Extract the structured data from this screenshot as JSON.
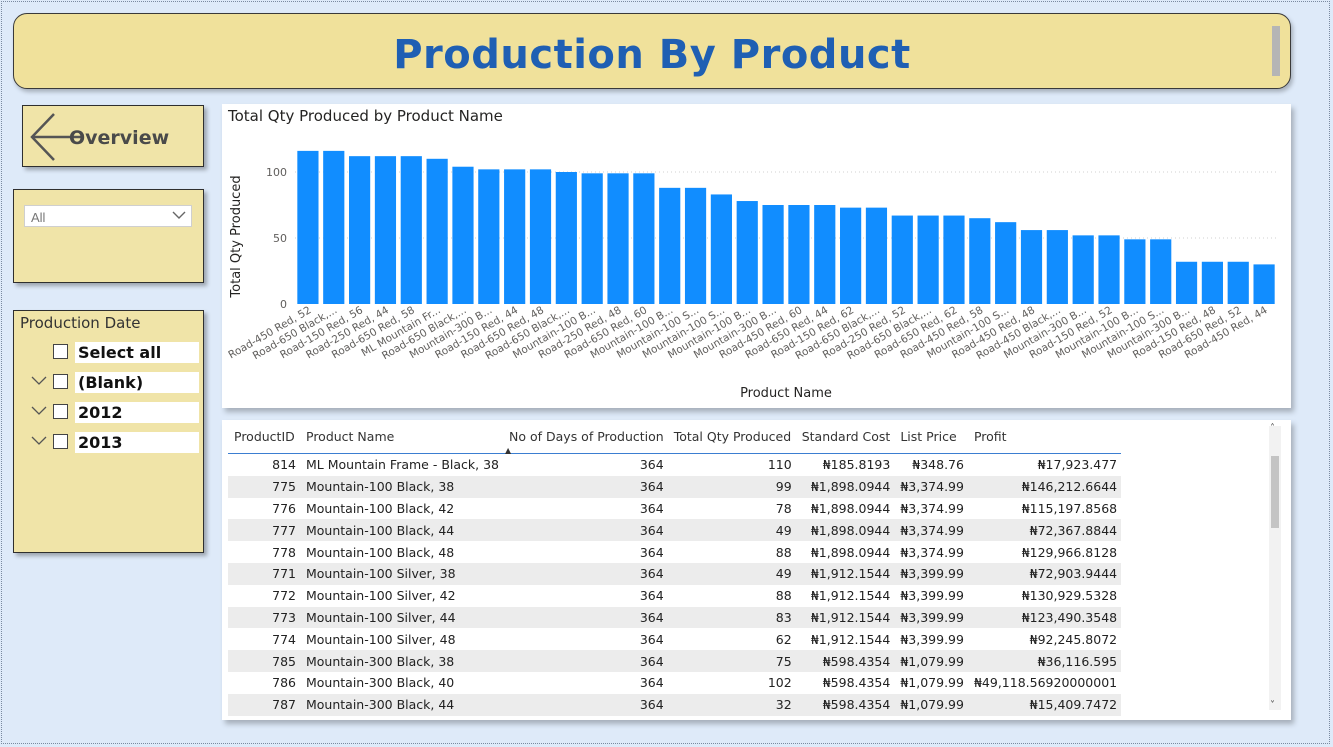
{
  "page": {
    "title": "Production By Product"
  },
  "nav": {
    "overview_label": "Overview"
  },
  "filter": {
    "selected": "All"
  },
  "date_slicer": {
    "title": "Production Date",
    "items": [
      "Select all",
      "(Blank)",
      "2012",
      "2013"
    ]
  },
  "chart_data": {
    "type": "bar",
    "title": "Total Qty Produced by Product Name",
    "xlabel": "Product Name",
    "ylabel": "Total Qty Produced",
    "ylim": [
      0,
      125
    ],
    "yticks": [
      0,
      50,
      100
    ],
    "grid": true,
    "color": "#118dff",
    "categories": [
      "Road-450 Red, 52",
      "Road-650 Black,...",
      "Road-150 Red, 56",
      "Road-250 Red, 44",
      "Road-650 Red, 58",
      "ML Mountain Fr...",
      "Road-650 Black,...",
      "Mountain-300 B...",
      "Road-150 Red, 44",
      "Road-650 Red, 48",
      "Road-650 Black,...",
      "Mountain-100 B...",
      "Road-250 Red, 48",
      "Road-650 Red, 60",
      "Mountain-100 B...",
      "Mountain-100 S...",
      "Mountain-100 S...",
      "Mountain-100 B...",
      "Mountain-300 B...",
      "Road-450 Red, 60",
      "Road-650 Red, 44",
      "Road-150 Red, 62",
      "Road-650 Black,...",
      "Road-250 Red, 52",
      "Road-650 Black,...",
      "Road-650 Red, 62",
      "Road-450 Red, 58",
      "Mountain-100 S...",
      "Road-450 Red, 48",
      "Road-450 Black,...",
      "Mountain-300 B...",
      "Road-150 Red, 52",
      "Mountain-100 B...",
      "Mountain-100 S...",
      "Mountain-300 B...",
      "Road-150 Red, 48",
      "Road-650 Red, 52",
      "Road-450 Red, 44"
    ],
    "values": [
      116,
      116,
      112,
      112,
      112,
      110,
      104,
      102,
      102,
      102,
      100,
      99,
      99,
      99,
      88,
      88,
      83,
      78,
      75,
      75,
      75,
      73,
      73,
      67,
      67,
      67,
      65,
      62,
      56,
      56,
      52,
      52,
      49,
      49,
      32,
      32,
      32,
      30
    ]
  },
  "table": {
    "columns": [
      "ProductID",
      "Product Name",
      "No of Days of Production",
      "Total Qty Produced",
      "Standard Cost",
      "List Price",
      "Profit"
    ],
    "sorted_column": "No of Days of Production",
    "rows": [
      [
        "814",
        "ML Mountain Frame - Black, 38",
        "364",
        "110",
        "₦185.8193",
        "₦348.76",
        "₦17,923.477"
      ],
      [
        "775",
        "Mountain-100 Black, 38",
        "364",
        "99",
        "₦1,898.0944",
        "₦3,374.99",
        "₦146,212.6644"
      ],
      [
        "776",
        "Mountain-100 Black, 42",
        "364",
        "78",
        "₦1,898.0944",
        "₦3,374.99",
        "₦115,197.8568"
      ],
      [
        "777",
        "Mountain-100 Black, 44",
        "364",
        "49",
        "₦1,898.0944",
        "₦3,374.99",
        "₦72,367.8844"
      ],
      [
        "778",
        "Mountain-100 Black, 48",
        "364",
        "88",
        "₦1,898.0944",
        "₦3,374.99",
        "₦129,966.8128"
      ],
      [
        "771",
        "Mountain-100 Silver, 38",
        "364",
        "49",
        "₦1,912.1544",
        "₦3,399.99",
        "₦72,903.9444"
      ],
      [
        "772",
        "Mountain-100 Silver, 42",
        "364",
        "88",
        "₦1,912.1544",
        "₦3,399.99",
        "₦130,929.5328"
      ],
      [
        "773",
        "Mountain-100 Silver, 44",
        "364",
        "83",
        "₦1,912.1544",
        "₦3,399.99",
        "₦123,490.3548"
      ],
      [
        "774",
        "Mountain-100 Silver, 48",
        "364",
        "62",
        "₦1,912.1544",
        "₦3,399.99",
        "₦92,245.8072"
      ],
      [
        "785",
        "Mountain-300 Black, 38",
        "364",
        "75",
        "₦598.4354",
        "₦1,079.99",
        "₦36,116.595"
      ],
      [
        "786",
        "Mountain-300 Black, 40",
        "364",
        "102",
        "₦598.4354",
        "₦1,079.99",
        "₦49,118.56920000001"
      ],
      [
        "787",
        "Mountain-300 Black, 44",
        "364",
        "32",
        "₦598.4354",
        "₦1,079.99",
        "₦15,409.7472"
      ]
    ]
  }
}
